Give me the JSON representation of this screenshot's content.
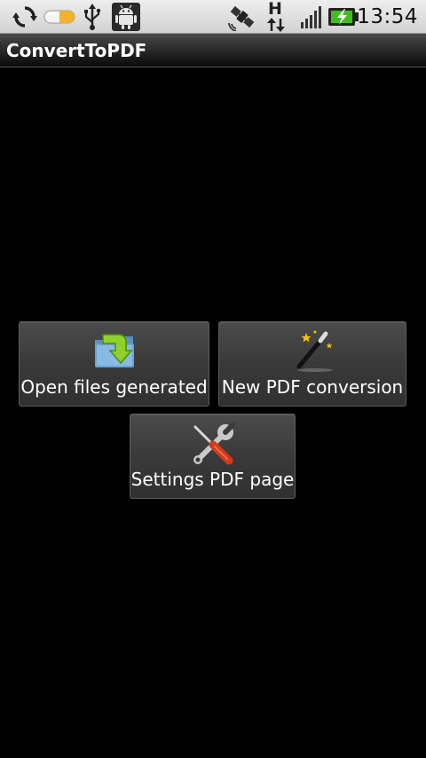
{
  "status_bar": {
    "time": "13:54",
    "network_letter": "H",
    "icons": [
      "sync-icon",
      "pill-icon",
      "usb-icon",
      "android-debug-icon",
      "gps-satellite-icon",
      "network-h-icon",
      "signal-bars-icon",
      "battery-charging-icon"
    ]
  },
  "app": {
    "title": "ConvertToPDF"
  },
  "buttons": {
    "open_files": {
      "label": "Open files generated",
      "icon": "folder-download-icon"
    },
    "new_conversion": {
      "label": "New PDF conversion",
      "icon": "magic-wand-icon"
    },
    "settings": {
      "label": "Settings PDF page",
      "icon": "tools-icon"
    }
  },
  "colors": {
    "background": "#000000",
    "status_bar": "#e0e0e0",
    "battery_fill": "#3fbf1f",
    "screwdriver_handle": "#d23a1c",
    "folder_blue": "#6aa3d6",
    "arrow_green": "#8ed12d"
  }
}
